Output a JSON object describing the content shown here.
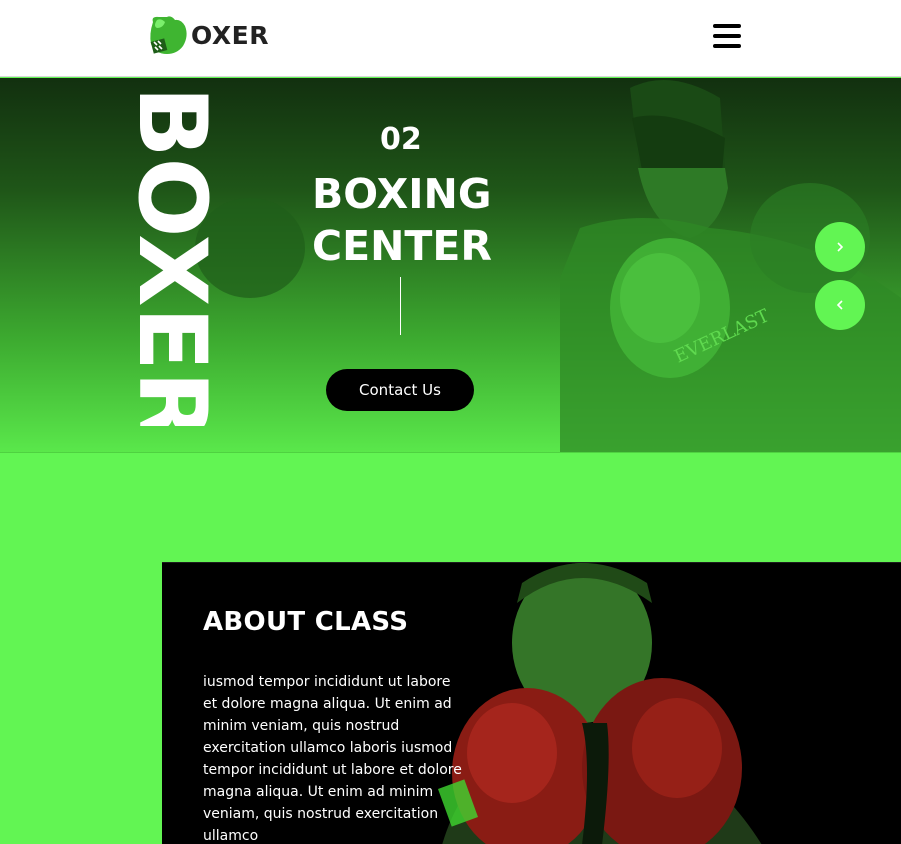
{
  "header": {
    "logo_text": "OXER",
    "logo_icon": "boxing-glove-icon",
    "menu_icon": "hamburger-menu-icon"
  },
  "hero": {
    "vertical_text": "BOXER",
    "slide_number": "02",
    "title_line1": "BOXING",
    "title_line2": "CENTER",
    "cta_label": "Contact Us",
    "next_icon": "chevron-right-icon",
    "prev_icon": "chevron-left-icon"
  },
  "about": {
    "title": "ABOUT CLASS",
    "body": "iusmod tempor incididunt ut labore et dolore magna aliqua. Ut enim ad minim veniam, quis nostrud exercitation ullamco laboris iusmod tempor incididunt ut labore et dolore magna aliqua. Ut enim ad minim veniam, quis nostrud exercitation ullamco"
  },
  "colors": {
    "accent": "#62f553",
    "dark": "#000000",
    "white": "#ffffff"
  }
}
